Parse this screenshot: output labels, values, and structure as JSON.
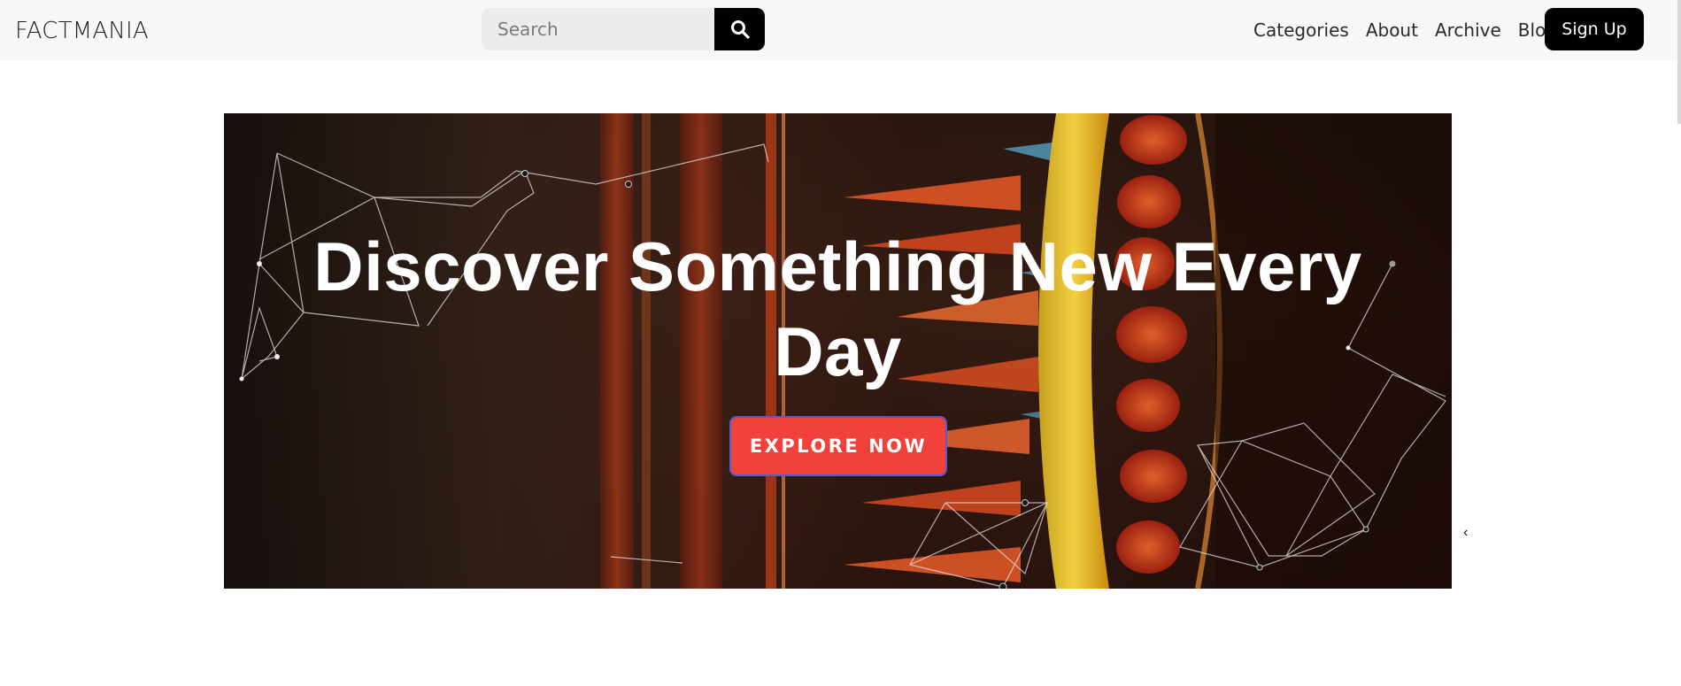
{
  "navbar": {
    "brand": "FACTMANIA",
    "search": {
      "placeholder": "Search",
      "button_icon": "search-icon"
    },
    "links": [
      "Categories",
      "About",
      "Archive",
      "Blog"
    ],
    "signup_label": "Sign Up"
  },
  "hero": {
    "title": "Discover Something New Every Day",
    "cta_label": "EXPLORE NOW",
    "background": "abstract dark red-orange scientific imagery with network line overlays",
    "colors": {
      "cta": "#f0413a",
      "title": "#ffffff"
    }
  },
  "colors": {
    "navbar_bg": "#f7f8fa",
    "button_dark": "#000000"
  }
}
